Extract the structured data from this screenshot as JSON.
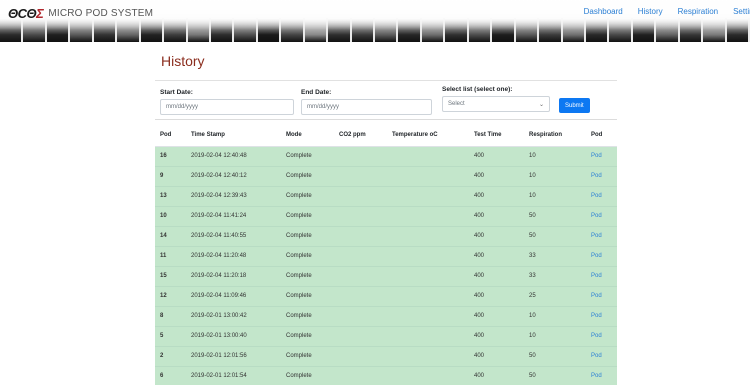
{
  "header": {
    "logo_text_a": "ΘCΘ",
    "logo_text_b": "Σ",
    "system_name": "MICRO POD SYSTEM",
    "nav": [
      "Dashboard",
      "History",
      "Respiration",
      "Settings"
    ]
  },
  "page": {
    "title": "History"
  },
  "filters": {
    "start_label": "Start Date:",
    "start_placeholder": "mm/dd/yyyy",
    "end_label": "End Date:",
    "end_placeholder": "mm/dd/yyyy",
    "list_label": "Select list (select one):",
    "list_selected": "Select",
    "submit_label": "Submit"
  },
  "table": {
    "columns": [
      "Pod",
      "Time Stamp",
      "Mode",
      "CO2 ppm",
      "Temperature oC",
      "Test Time",
      "Respiration",
      "Pod"
    ],
    "rows": [
      {
        "pod": "16",
        "ts": "2019-02-04 12:40:48",
        "mode": "Complete",
        "co2": "",
        "temp": "",
        "test": "400",
        "resp": "10",
        "link": "Pod"
      },
      {
        "pod": "9",
        "ts": "2019-02-04 12:40:12",
        "mode": "Complete",
        "co2": "",
        "temp": "",
        "test": "400",
        "resp": "10",
        "link": "Pod"
      },
      {
        "pod": "13",
        "ts": "2019-02-04 12:39:43",
        "mode": "Complete",
        "co2": "",
        "temp": "",
        "test": "400",
        "resp": "10",
        "link": "Pod"
      },
      {
        "pod": "10",
        "ts": "2019-02-04 11:41:24",
        "mode": "Complete",
        "co2": "",
        "temp": "",
        "test": "400",
        "resp": "50",
        "link": "Pod"
      },
      {
        "pod": "14",
        "ts": "2019-02-04 11:40:55",
        "mode": "Complete",
        "co2": "",
        "temp": "",
        "test": "400",
        "resp": "50",
        "link": "Pod"
      },
      {
        "pod": "11",
        "ts": "2019-02-04 11:20:48",
        "mode": "Complete",
        "co2": "",
        "temp": "",
        "test": "400",
        "resp": "33",
        "link": "Pod"
      },
      {
        "pod": "15",
        "ts": "2019-02-04 11:20:18",
        "mode": "Complete",
        "co2": "",
        "temp": "",
        "test": "400",
        "resp": "33",
        "link": "Pod"
      },
      {
        "pod": "12",
        "ts": "2019-02-04 11:09:46",
        "mode": "Complete",
        "co2": "",
        "temp": "",
        "test": "400",
        "resp": "25",
        "link": "Pod"
      },
      {
        "pod": "8",
        "ts": "2019-02-01 13:00:42",
        "mode": "Complete",
        "co2": "",
        "temp": "",
        "test": "400",
        "resp": "10",
        "link": "Pod"
      },
      {
        "pod": "5",
        "ts": "2019-02-01 13:00:40",
        "mode": "Complete",
        "co2": "",
        "temp": "",
        "test": "400",
        "resp": "10",
        "link": "Pod"
      },
      {
        "pod": "2",
        "ts": "2019-02-01 12:01:56",
        "mode": "Complete",
        "co2": "",
        "temp": "",
        "test": "400",
        "resp": "50",
        "link": "Pod"
      },
      {
        "pod": "6",
        "ts": "2019-02-01 12:01:54",
        "mode": "Complete",
        "co2": "",
        "temp": "",
        "test": "400",
        "resp": "50",
        "link": "Pod"
      }
    ]
  },
  "colors": {
    "accent": "#0d78f2",
    "link": "#2b7fd4",
    "title": "#8b2d1e",
    "row_success": "#c3e6cb"
  }
}
